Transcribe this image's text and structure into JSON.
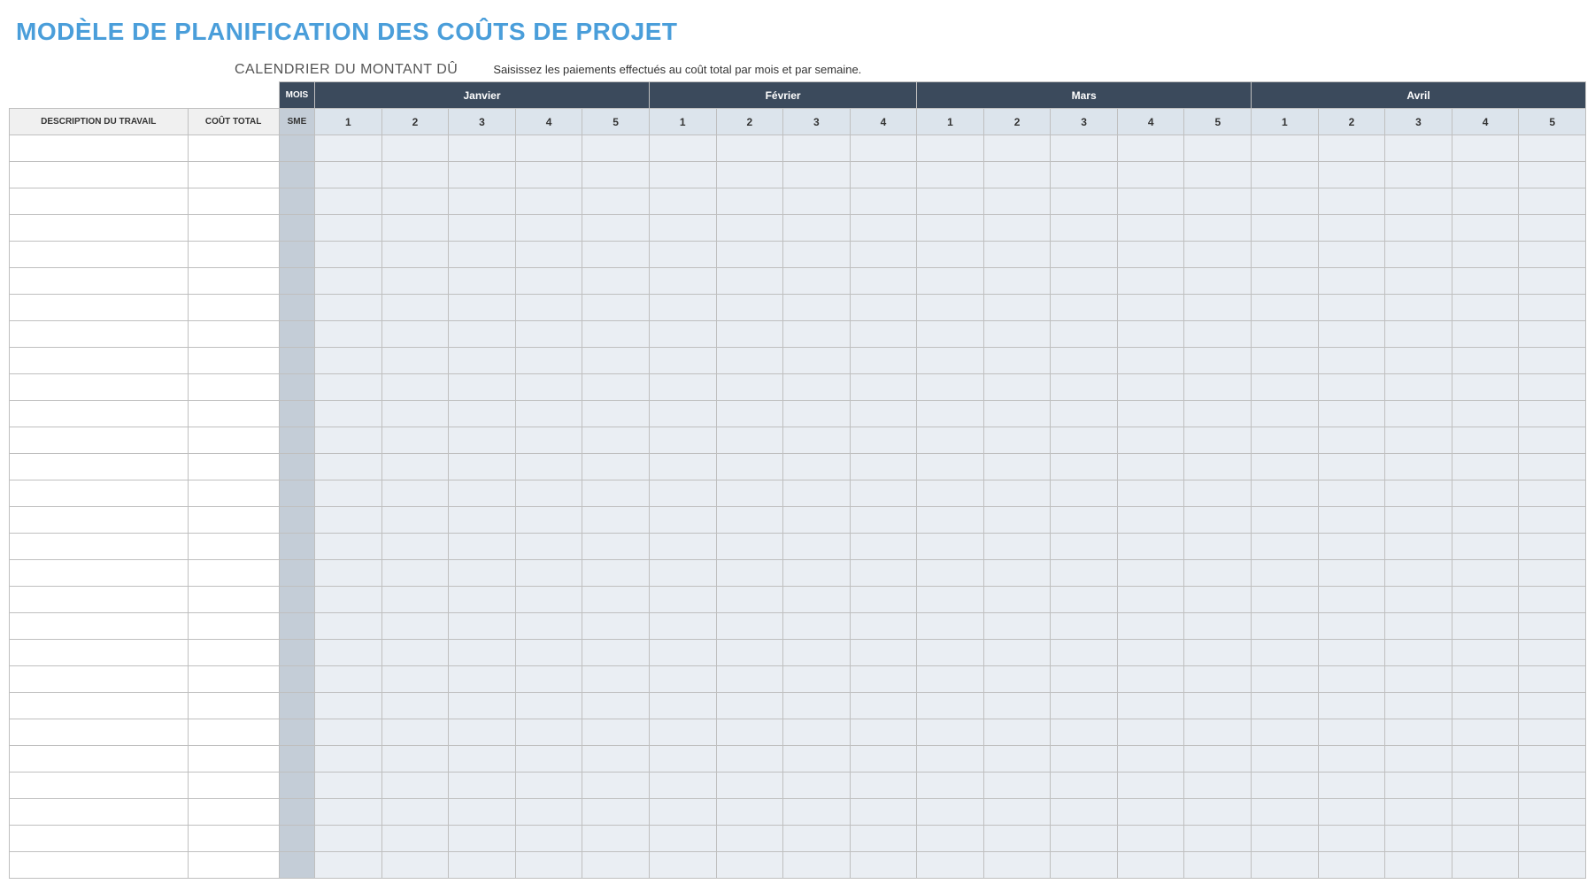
{
  "title": "MODÈLE DE PLANIFICATION DES COÛTS DE PROJET",
  "subtitle": "CALENDRIER DU MONTANT DÛ",
  "instructions": "Saisissez les paiements effectués au coût total par mois et par semaine.",
  "headers": {
    "mois": "MOIS",
    "description": "DESCRIPTION DU TRAVAIL",
    "cout_total": "COÛT TOTAL",
    "sme": "SME"
  },
  "months": [
    {
      "name": "Janvier",
      "weeks": [
        1,
        2,
        3,
        4,
        5
      ]
    },
    {
      "name": "Février",
      "weeks": [
        1,
        2,
        3,
        4
      ]
    },
    {
      "name": "Mars",
      "weeks": [
        1,
        2,
        3,
        4,
        5
      ]
    },
    {
      "name": "Avril",
      "weeks": [
        1,
        2,
        3,
        4,
        5
      ]
    }
  ],
  "row_count": 28
}
